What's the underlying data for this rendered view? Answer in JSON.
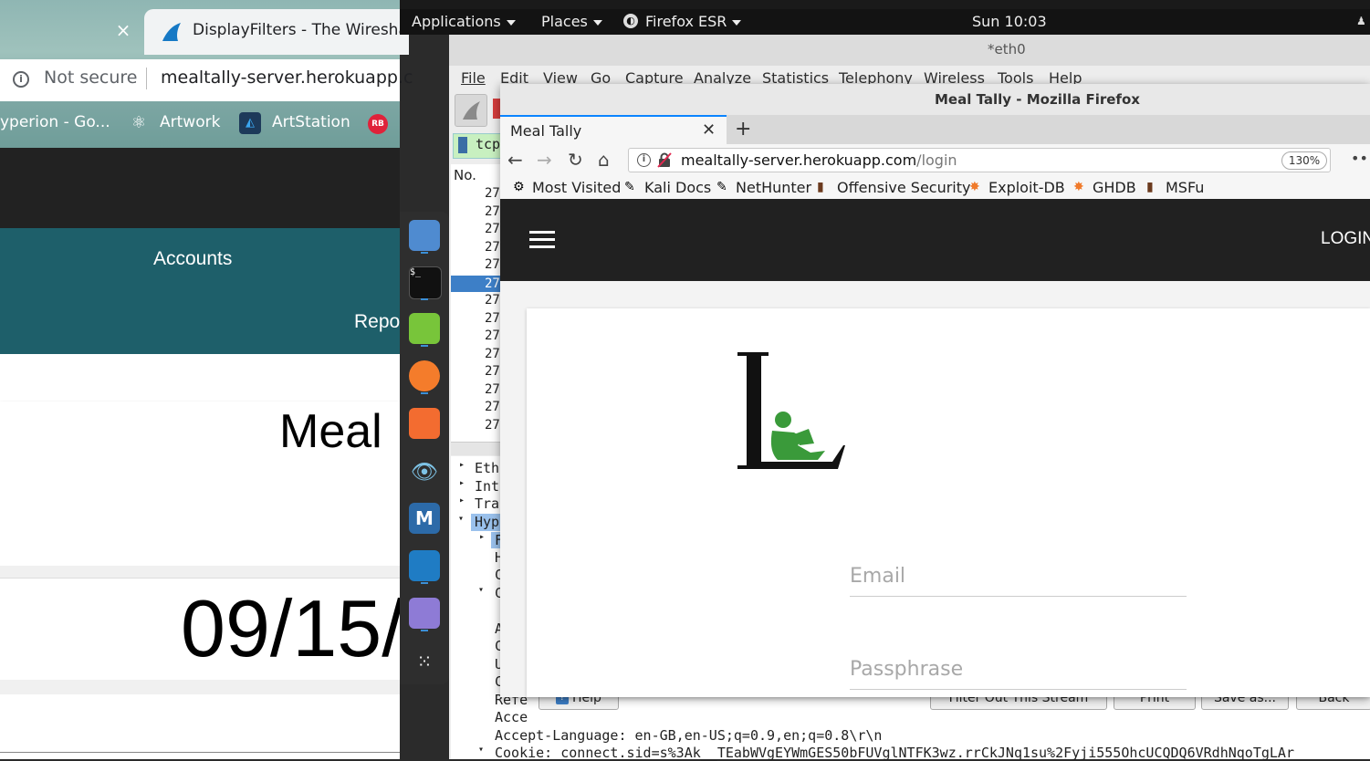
{
  "chrome": {
    "tab_close": "×",
    "tab2_title": "DisplayFilters - The Wireshar",
    "not_secure": "Not secure",
    "url": "mealtally-server.herokuapp.c",
    "bookmarks": {
      "item1": "yperion - Go...",
      "item2": "Artwork",
      "item3": "ArtStation",
      "item4_icon_text": "RB"
    }
  },
  "app_left": {
    "nav_accounts": "Accounts",
    "nav_reports": "Repo",
    "card_title": "Meal",
    "date": "09/15/"
  },
  "gnome": {
    "applications": "Applications",
    "places": "Places",
    "firefox": "Firefox ESR",
    "clock": "Sun 10:03"
  },
  "wireshark": {
    "title": "*eth0",
    "menu": [
      "File",
      "Edit",
      "View",
      "Go",
      "Capture",
      "Analyze",
      "Statistics",
      "Telephony",
      "Wireless",
      "Tools",
      "Help"
    ],
    "filter_text": "tcp.",
    "col_no": "No.",
    "rows": [
      "27",
      "27",
      "27",
      "27",
      "27",
      "27",
      "27",
      "27",
      "27",
      "27",
      "27",
      "27",
      "27",
      "27"
    ],
    "detail": {
      "eth": "Eth",
      "int": "Int",
      "tra": "Tra",
      "hyp": "Hyp",
      "sub1": "F",
      "l_h": "H",
      "l_c1": "C",
      "l_c2": "C",
      "l_a": "A",
      "l_c3": "C",
      "l_u": "U",
      "l_c4": "C",
      "refe": "Refe",
      "acce": "Acce",
      "accept_lang": "Accept-Language: en-GB,en-US;q=0.9,en;q=0.8\\r\\n",
      "cookie": "Cookie: connect.sid=s%3Ak__TEabWVgEYWmGES50bFUVglNTFK3wz.rrCkJNq1su%2Fyji555OhcUCQDQ6VRdhNqoTgLAr"
    },
    "buttons": {
      "help": "Help",
      "filter_out": "Filter Out This Stream",
      "print": "Print",
      "save_as": "Save as...",
      "back": "Back"
    }
  },
  "firefox": {
    "window_title": "Meal Tally - Mozilla Firefox",
    "tab_title": "Meal Tally",
    "url_host": "mealtally-server.herokuapp.com",
    "url_path": "/login",
    "zoom": "130%",
    "bookmarks": [
      "Most Visited",
      "Kali Docs",
      "NetHunter",
      "Offensive Security",
      "Exploit-DB",
      "GHDB",
      "MSFu"
    ],
    "login_link": "LOGIN",
    "email_placeholder": "Email",
    "pass_placeholder": "Passphrase"
  },
  "colors": {
    "chrome_accent": "#1a73e8",
    "teal_nav": "#1e5f6a",
    "app_dark": "#222222",
    "ff_blue": "#0a84ff",
    "logo_green": "#3a9a3a",
    "ws_selection": "#3d7fc7"
  }
}
